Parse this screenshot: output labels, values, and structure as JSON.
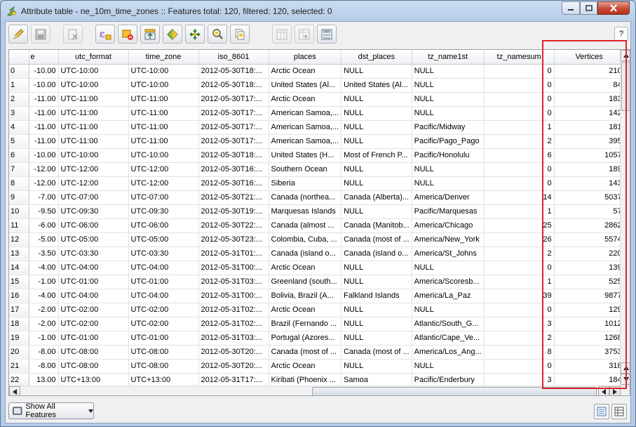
{
  "window": {
    "title": "Attribute table - ne_10m_time_zones :: Features total: 120, filtered: 120, selected: 0"
  },
  "toolbar": {
    "buttons": [
      {
        "name": "toggle-editing",
        "icon": "pencil-icon"
      },
      {
        "name": "save-edits",
        "icon": "save-icon"
      },
      {
        "name": "delete-selected",
        "icon": "delete-features-icon"
      },
      {
        "name": "select-by-expression",
        "icon": "expression-select-icon"
      },
      {
        "name": "deselect-all",
        "icon": "deselect-icon"
      },
      {
        "name": "move-selection-to-top",
        "icon": "move-top-icon"
      },
      {
        "name": "invert-selection",
        "icon": "invert-selection-icon"
      },
      {
        "name": "pan-map-to-selected",
        "icon": "pan-map-icon"
      },
      {
        "name": "zoom-to-selected",
        "icon": "zoom-selected-icon"
      },
      {
        "name": "copy-selected-rows",
        "icon": "copy-icon"
      },
      {
        "name": "delete-column",
        "icon": "delete-column-icon"
      },
      {
        "name": "new-column",
        "icon": "new-column-icon"
      },
      {
        "name": "field-calculator",
        "icon": "field-calculator-icon"
      }
    ],
    "help_label": "?"
  },
  "table": {
    "columns": [
      "e",
      "utc_format",
      "time_zone",
      "iso_8601",
      "places",
      "dst_places",
      "tz_name1st",
      "tz_namesum",
      "Vertices"
    ],
    "rows": [
      [
        "0",
        "-10.00",
        "UTC-10:00",
        "UTC-10:00",
        "2012-05-30T18:...",
        "Arctic Ocean",
        "NULL",
        "NULL",
        "0",
        "210"
      ],
      [
        "1",
        "-10.00",
        "UTC-10:00",
        "UTC-10:00",
        "2012-05-30T18:...",
        "United States (Al...",
        "United States (Al...",
        "NULL",
        "0",
        "84"
      ],
      [
        "2",
        "-11.00",
        "UTC-11:00",
        "UTC-11:00",
        "2012-05-30T17:...",
        "Arctic Ocean",
        "NULL",
        "NULL",
        "0",
        "183"
      ],
      [
        "3",
        "-11.00",
        "UTC-11:00",
        "UTC-11:00",
        "2012-05-30T17:...",
        "American Samoa,...",
        "NULL",
        "NULL",
        "0",
        "142"
      ],
      [
        "4",
        "-11.00",
        "UTC-11:00",
        "UTC-11:00",
        "2012-05-30T17:...",
        "American Samoa,...",
        "NULL",
        "Pacific/Midway",
        "1",
        "181"
      ],
      [
        "5",
        "-11.00",
        "UTC-11:00",
        "UTC-11:00",
        "2012-05-30T17:...",
        "American Samoa,...",
        "NULL",
        "Pacific/Pago_Pago",
        "2",
        "395"
      ],
      [
        "6",
        "-10.00",
        "UTC-10:00",
        "UTC-10:00",
        "2012-05-30T18:...",
        "United States (H...",
        "Most of French P...",
        "Pacific/Honolulu",
        "6",
        "1057"
      ],
      [
        "7",
        "-12.00",
        "UTC-12:00",
        "UTC-12:00",
        "2012-05-30T16:...",
        "Southern Ocean",
        "NULL",
        "NULL",
        "0",
        "189"
      ],
      [
        "8",
        "-12.00",
        "UTC-12:00",
        "UTC-12:00",
        "2012-05-30T16:...",
        "Siberia",
        "NULL",
        "NULL",
        "0",
        "143"
      ],
      [
        "9",
        "-7.00",
        "UTC-07:00",
        "UTC-07:00",
        "2012-05-30T21:...",
        "Canada (northea...",
        "Canada (Alberta)...",
        "America/Denver",
        "14",
        "5037"
      ],
      [
        "10",
        "-9.50",
        "UTC-09:30",
        "UTC-09:30",
        "2012-05-30T19:...",
        "Marquesas Islands",
        "NULL",
        "Pacific/Marquesas",
        "1",
        "57"
      ],
      [
        "11",
        "-6.00",
        "UTC-06:00",
        "UTC-06:00",
        "2012-05-30T22:...",
        "Canada (almost ...",
        "Canada (Manitob...",
        "America/Chicago",
        "25",
        "2862"
      ],
      [
        "12",
        "-5.00",
        "UTC-05:00",
        "UTC-05:00",
        "2012-05-30T23:...",
        "Colombia, Cuba, ...",
        "Canada (most of ...",
        "America/New_York",
        "26",
        "5574"
      ],
      [
        "13",
        "-3.50",
        "UTC-03:30",
        "UTC-03:30",
        "2012-05-31T01:...",
        "Canada (island o...",
        "Canada (island o...",
        "America/St_Johns",
        "2",
        "220"
      ],
      [
        "14",
        "-4.00",
        "UTC-04:00",
        "UTC-04:00",
        "2012-05-31T00:...",
        "Arctic Ocean",
        "NULL",
        "NULL",
        "0",
        "139"
      ],
      [
        "15",
        "-1.00",
        "UTC-01:00",
        "UTC-01:00",
        "2012-05-31T03:...",
        "Greenland (south...",
        "NULL",
        "America/Scoresb...",
        "1",
        "525"
      ],
      [
        "16",
        "-4.00",
        "UTC-04:00",
        "UTC-04:00",
        "2012-05-31T00:...",
        "Bolivia, Brazil (A...",
        "Falkland Islands",
        "America/La_Paz",
        "39",
        "9877"
      ],
      [
        "17",
        "-2.00",
        "UTC-02:00",
        "UTC-02:00",
        "2012-05-31T02:...",
        "Arctic Ocean",
        "NULL",
        "NULL",
        "0",
        "129"
      ],
      [
        "18",
        "-2.00",
        "UTC-02:00",
        "UTC-02:00",
        "2012-05-31T02:...",
        "Brazil (Fernando ...",
        "NULL",
        "Atlantic/South_G...",
        "3",
        "1012"
      ],
      [
        "19",
        "-1.00",
        "UTC-01:00",
        "UTC-01:00",
        "2012-05-31T03:...",
        "Portugal (Azores...",
        "NULL",
        "Atlantic/Cape_Ve...",
        "2",
        "1268"
      ],
      [
        "20",
        "-8.00",
        "UTC-08:00",
        "UTC-08:00",
        "2012-05-30T20:...",
        "Canada (most of ...",
        "Canada (most of ...",
        "America/Los_Ang...",
        "8",
        "3753"
      ],
      [
        "21",
        "-8.00",
        "UTC-08:00",
        "UTC-08:00",
        "2012-05-30T20:...",
        "Arctic Ocean",
        "NULL",
        "NULL",
        "0",
        "318"
      ],
      [
        "22",
        "13.00",
        "UTC+13:00",
        "UTC+13:00",
        "2012-05-31T17:...",
        "Kiribati (Phoenix ...",
        "Samoa",
        "Pacific/Enderbury",
        "3",
        "184"
      ]
    ]
  },
  "bottom": {
    "filter_label": "Show All Features"
  },
  "colors": {
    "highlight_box": "#e0222c"
  }
}
